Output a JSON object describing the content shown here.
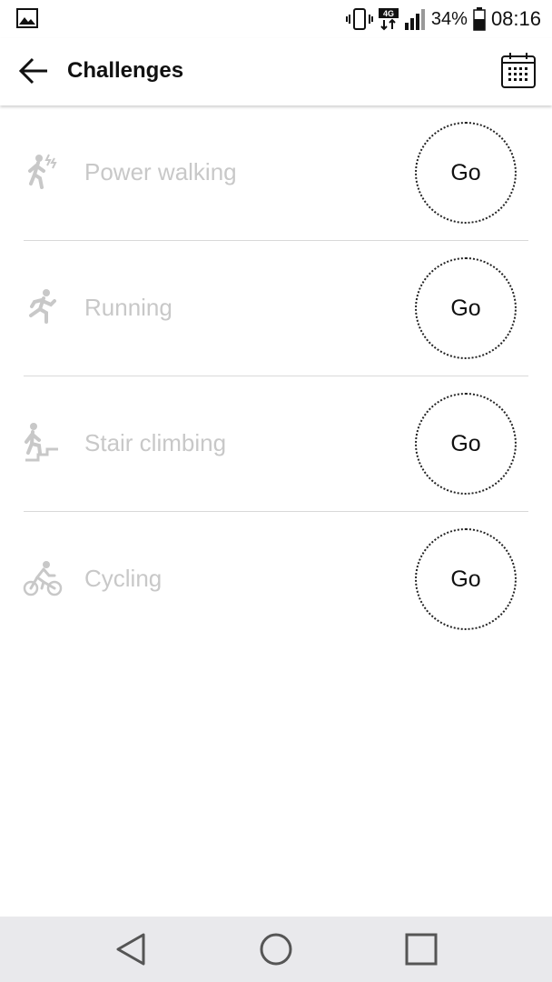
{
  "status_bar": {
    "network": "4G",
    "battery_percent": "34%",
    "time": "08:16",
    "icons": [
      "gallery-icon",
      "vibrate-icon",
      "network-4g-icon",
      "signal-icon",
      "battery-icon"
    ]
  },
  "app_bar": {
    "title": "Challenges",
    "icons": [
      "back-arrow-icon",
      "calendar-icon"
    ]
  },
  "challenges": [
    {
      "label": "Power walking",
      "icon": "power-walking-icon",
      "action": "Go"
    },
    {
      "label": "Running",
      "icon": "running-icon",
      "action": "Go"
    },
    {
      "label": "Stair climbing",
      "icon": "stair-climbing-icon",
      "action": "Go"
    },
    {
      "label": "Cycling",
      "icon": "cycling-icon",
      "action": "Go"
    }
  ],
  "nav_bar": {
    "icons": [
      "back-triangle-icon",
      "home-circle-icon",
      "recents-square-icon"
    ]
  },
  "colors": {
    "label_gray": "#c8c8c8",
    "nav_bg": "#e9e9ec",
    "divider": "#d9d9d9"
  }
}
